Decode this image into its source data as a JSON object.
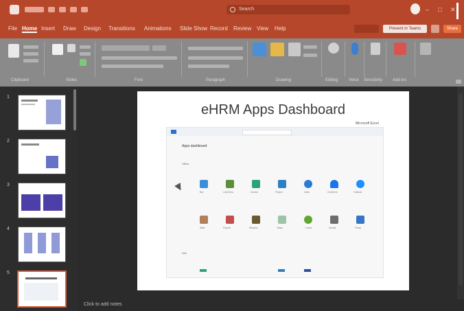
{
  "window": {
    "title": "",
    "search_placeholder": "Search",
    "controls": [
      "–",
      "□",
      "✕"
    ]
  },
  "tabs": [
    {
      "label": "File"
    },
    {
      "label": "Home",
      "active": true
    },
    {
      "label": "Insert"
    },
    {
      "label": "Draw"
    },
    {
      "label": "Design"
    },
    {
      "label": "Transitions"
    },
    {
      "label": "Animations"
    },
    {
      "label": "Slide Show"
    },
    {
      "label": "Record"
    },
    {
      "label": "Review"
    },
    {
      "label": "View"
    },
    {
      "label": "Help"
    }
  ],
  "tab_buttons": {
    "record": "",
    "present": "Present in Teams",
    "share": "Share"
  },
  "ribbon": {
    "groups": [
      {
        "label": "Clipboard"
      },
      {
        "label": "Slides"
      },
      {
        "label": "Font"
      },
      {
        "label": "Paragraph"
      },
      {
        "label": "Drawing"
      },
      {
        "label": "Editing"
      },
      {
        "label": "Voice"
      },
      {
        "label": "Sensitivity"
      },
      {
        "label": "Add-ins"
      }
    ]
  },
  "thumbnails": [
    {
      "num": "1"
    },
    {
      "num": "2"
    },
    {
      "num": "3"
    },
    {
      "num": "4"
    },
    {
      "num": "5",
      "selected": true
    }
  ],
  "slide": {
    "title": "eHRM Apps Dashboard",
    "subtitle": "Microsoft Excel",
    "screenshot": {
      "heading": "Apps dashboard",
      "section1": "Office",
      "section2": "Ads",
      "apps_row1": [
        "Bar",
        "Line/Area",
        "Invoice",
        "Project",
        "Calls",
        "OneDrive",
        "Outlook"
      ],
      "apps_row2": [
        "Staff",
        "Payroll",
        "Reports",
        "Tasks",
        "Leave",
        "Assets",
        "Portal"
      ]
    }
  },
  "notes_placeholder": "Click to add notes",
  "colors": {
    "accent": "#b7472a",
    "ribbon": "#8a8a8a",
    "pane": "#2b2b2b"
  }
}
